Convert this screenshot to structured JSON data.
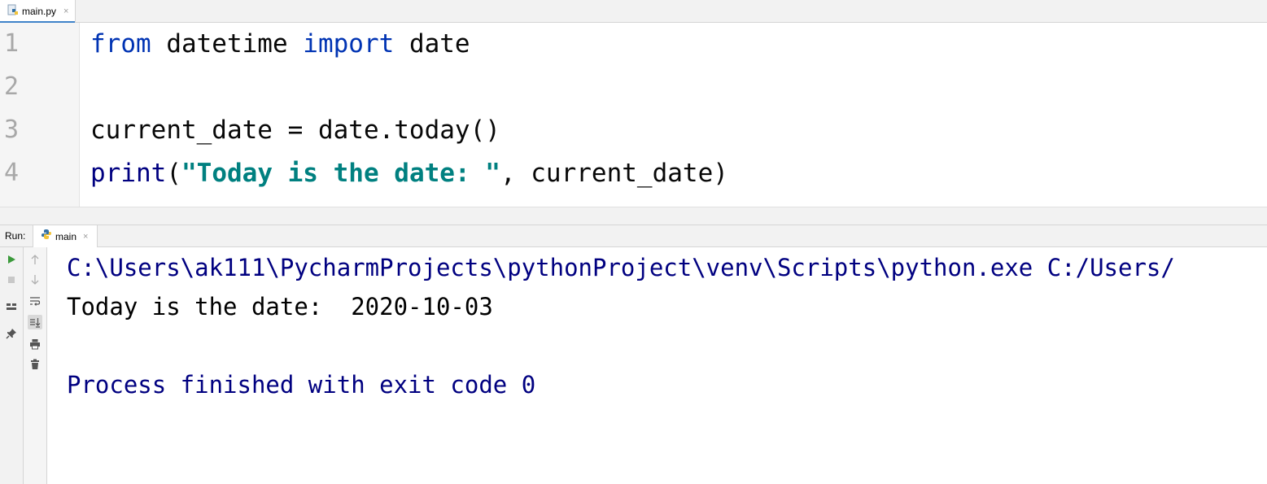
{
  "editor_tab": {
    "label": "main.py",
    "close": "×"
  },
  "editor": {
    "line_numbers": [
      "1",
      "2",
      "3",
      "4"
    ],
    "lines": [
      {
        "kw1": "from",
        "t1": " datetime ",
        "kw2": "import",
        "t2": " date"
      },
      {},
      {
        "text": "current_date = date.today()"
      },
      {
        "fn": "print",
        "p1": "(",
        "str": "\"Today is the date: \"",
        "rest": ", current_date)"
      }
    ]
  },
  "run": {
    "title": "Run:",
    "tab_label": "main",
    "tab_close": "×",
    "toolbar_left": [
      "run-icon",
      "stop-icon",
      "layout-icon",
      "pin-icon"
    ],
    "toolbar_right": [
      "up-arrow-icon",
      "down-arrow-icon",
      "soft-wrap-icon",
      "scroll-to-end-icon",
      "print-icon",
      "trash-icon"
    ]
  },
  "console": {
    "command": "C:\\Users\\ak111\\PycharmProjects\\pythonProject\\venv\\Scripts\\python.exe C:/Users/",
    "output": "Today is the date:  2020-10-03",
    "exit": "Process finished with exit code 0"
  },
  "colors": {
    "keyword": "#0033b3",
    "builtin": "#000080",
    "string": "#008080",
    "console_system": "#000080",
    "run_green": "#3b9a3b",
    "tab_underline": "#4083c9"
  }
}
